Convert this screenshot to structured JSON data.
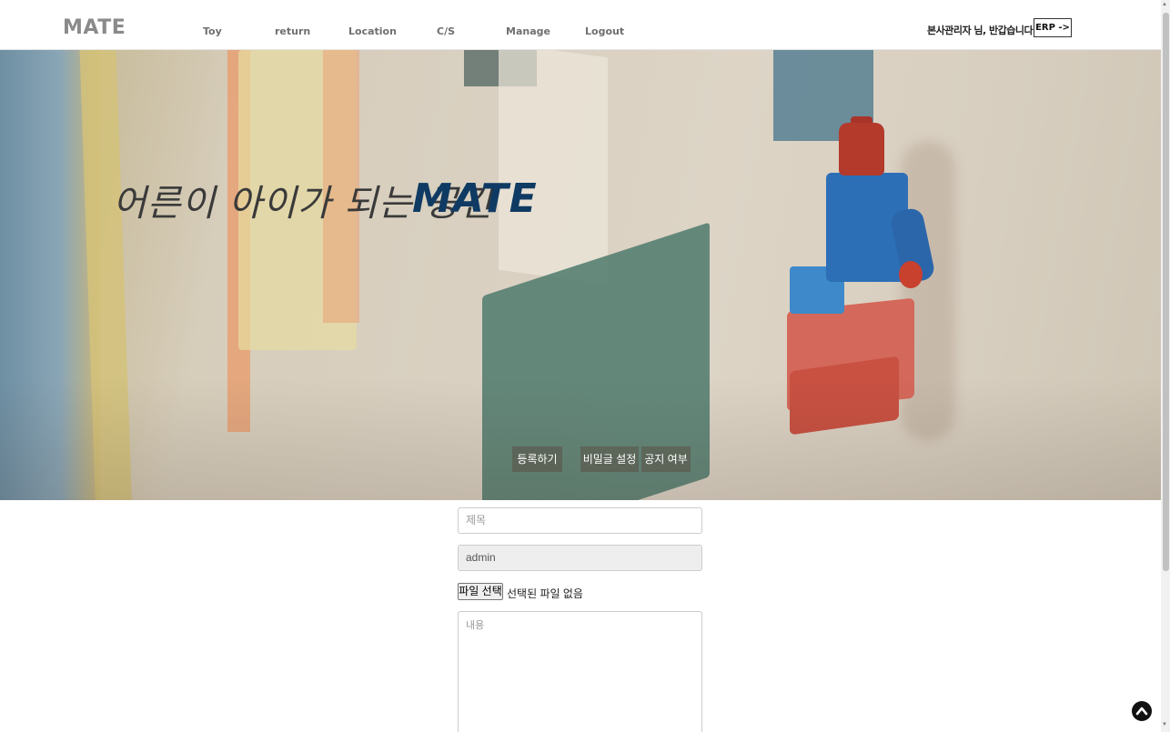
{
  "header": {
    "logo": "MATE",
    "nav": [
      "Toy",
      "return",
      "Location",
      "C/S",
      "Manage",
      "Logout"
    ],
    "greeting": "본사관리자 님, 반갑습니다.",
    "erp_button": "ERP ->"
  },
  "hero": {
    "slogan": "어른이 아이가 되는 공간",
    "brand": "MATE",
    "buttons": {
      "register": "등록하기",
      "password": "비밀글 설정",
      "notice": "공지 여부"
    }
  },
  "form": {
    "title_placeholder": "제목",
    "writer_value": "admin",
    "file_button": "파일 선택",
    "file_status": "선택된 파일 없음",
    "content_placeholder": "내용"
  },
  "colors": {
    "brand_navy": "#0f3a63",
    "nav_gray": "#6f6f6f"
  },
  "icons": {
    "top_button": "chevron-up-circle-icon"
  }
}
